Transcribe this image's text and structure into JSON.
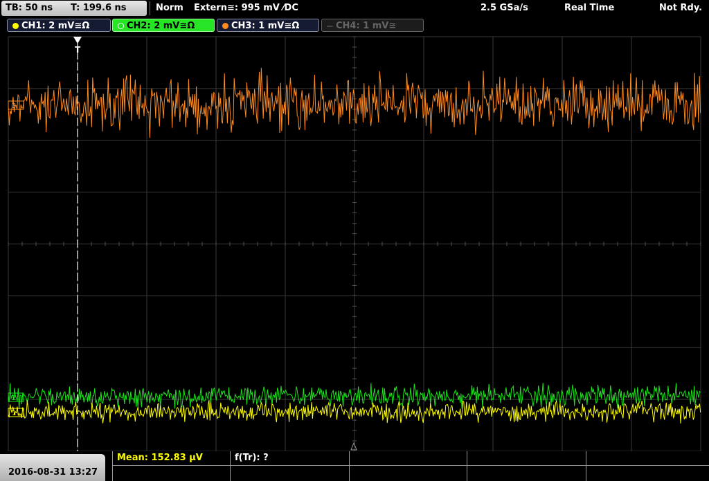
{
  "top_bar": {
    "timebase": "TB: 50 ns",
    "trigger_time": "T: 199.6 ns",
    "mode": "Norm",
    "trigger_source": "Extern≅: 995 mV ⁄DC",
    "sample_rate": "2.5 GSa/s",
    "acquisition": "Real Time",
    "status": "Not Rdy."
  },
  "channels": [
    {
      "label": "CH1: 2 mV≅Ω",
      "color": "#ffff00",
      "active": false
    },
    {
      "label": "CH2: 2 mV≅Ω",
      "color": "#19e619",
      "active": true
    },
    {
      "label": "CH3: 1 mV≅Ω",
      "color": "#ff8a1f",
      "active": false
    },
    {
      "label": "CH4: 1 mV≅",
      "color": "#666666",
      "active": false
    }
  ],
  "markers": {
    "trigger_position": "T",
    "ch3_marker": "3",
    "ch2_marker": "2",
    "ch1_marker": "1"
  },
  "bottom_bar": {
    "datetime": "2016-08-31 13:27",
    "measurements": [
      {
        "label": "Mean: 152.83 µV",
        "color": "#ffff00"
      },
      {
        "label": "f(Tr): ?",
        "color": "#ffffff"
      }
    ]
  },
  "colors": {
    "grid": "#3a3a3a",
    "ch1": "#ffff00",
    "ch2": "#19e619",
    "ch3": "#ff8a1f",
    "trigger_line": "#ffffff"
  }
}
